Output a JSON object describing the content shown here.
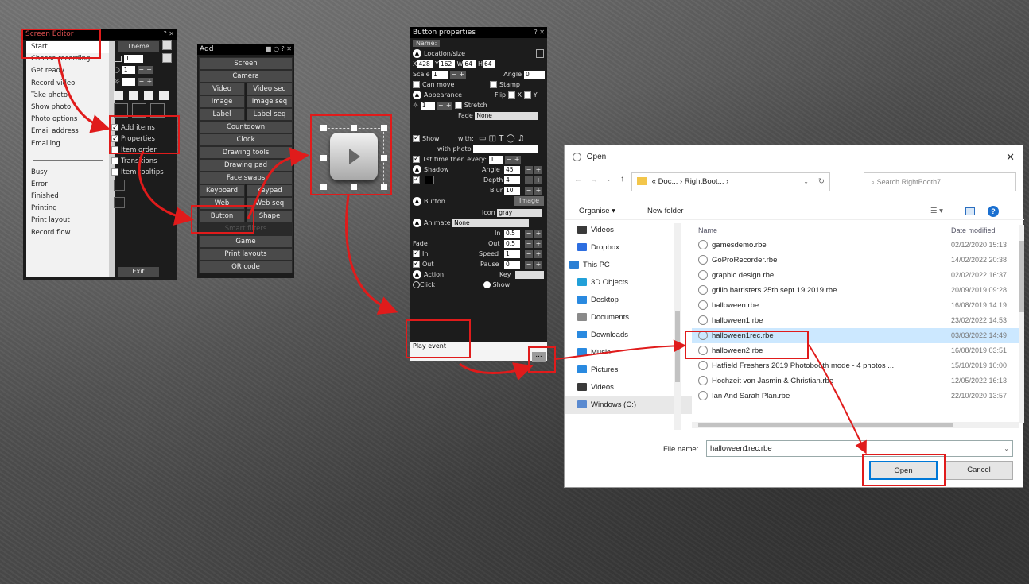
{
  "screen_editor": {
    "title": "Screen Editor",
    "list": [
      "Start",
      "Choose recording",
      "Get ready",
      "Record video",
      "Take photo",
      "Show photo",
      "Photo options",
      "Email address",
      "Emailing",
      "Busy",
      "Error",
      "Finished",
      "Printing",
      "Print layout",
      "Record flow"
    ],
    "theme_label": "Theme",
    "zoom_value": "1",
    "brightness_value": "1",
    "zoom_value2": "1",
    "checks": [
      {
        "label": "Add items",
        "checked": true
      },
      {
        "label": "Properties",
        "checked": true
      },
      {
        "label": "Item order",
        "checked": false
      },
      {
        "label": "Transitions",
        "checked": false
      },
      {
        "label": "Item tooltips",
        "checked": false
      }
    ],
    "exit_label": "Exit"
  },
  "add_panel": {
    "title": "Add",
    "full_buttons_top": [
      "Screen",
      "Camera"
    ],
    "pairs1": [
      [
        "Video",
        "Video seq"
      ],
      [
        "Image",
        "Image seq"
      ],
      [
        "Label",
        "Label seq"
      ]
    ],
    "full_buttons_mid": [
      "Countdown",
      "Clock",
      "Drawing tools",
      "Drawing pad",
      "Face swaps"
    ],
    "pairs2": [
      [
        "Keyboard",
        "Keypad"
      ],
      [
        "Web",
        "Web seq"
      ],
      [
        "Button",
        "Shape"
      ]
    ],
    "disabled": "Smart filters",
    "full_buttons_bottom": [
      "Game",
      "Print layouts",
      "QR code"
    ]
  },
  "button_properties": {
    "title": "Button properties",
    "name_label": "Name:",
    "location_label": "Location/size",
    "x_label": "X",
    "x_value": "428",
    "y_label": "Y",
    "y_value": "162",
    "w_label": "W",
    "w_value": "64",
    "h_label": "H",
    "h_value": "64",
    "scale_label": "Scale",
    "scale_value": "1",
    "angle_label": "Angle",
    "angle_value": "0",
    "can_move": "Can move",
    "stamp": "Stamp",
    "appearance_label": "Appearance",
    "flip_label": "Flip",
    "flip_x": "X",
    "flip_y": "Y",
    "stretch_label": "Stretch",
    "opacity_value": "1",
    "fade_label": "Fade",
    "fade_value": "None",
    "show_label": "Show",
    "with_label": "with:",
    "with_photo": "with photo",
    "first_time_label": "1st time then every:",
    "first_time_value": "1",
    "shadow_label": "Shadow",
    "angle2_value": "45",
    "depth_label": "Depth",
    "depth_value": "4",
    "blur_label": "Blur",
    "blur_value": "10",
    "button_section": "Button",
    "image_btn": "Image",
    "icon_label": "Icon",
    "icon_value": "gray",
    "animate_label": "Animate",
    "animate_value": "None",
    "in_label": "In",
    "in_value": "0.5",
    "out_label": "Out",
    "out_value": "0.5",
    "fade2_label": "Fade",
    "fade_in": "In",
    "fade_out": "Out",
    "speed_label": "Speed",
    "speed_value": "1",
    "pause_label": "Pause",
    "pause_value": "0",
    "action_label": "Action",
    "key_label": "Key",
    "click_label": "Click",
    "show2_label": "Show",
    "action_value": "Play event",
    "browse_label": "..."
  },
  "open_dialog": {
    "title": "Open",
    "path_parts": [
      "Doc...",
      "RightBoot...",
      ""
    ],
    "search_placeholder": "Search RightBooth7",
    "organise": "Organise ▾",
    "new_folder": "New folder",
    "nav_items": [
      {
        "label": "Videos",
        "color": "#3a3a3a"
      },
      {
        "label": "Dropbox",
        "color": "#2d6ee0"
      },
      {
        "label": "This PC",
        "color": "#2a7fd4"
      },
      {
        "label": "3D Objects",
        "color": "#22a0d8"
      },
      {
        "label": "Desktop",
        "color": "#2a8ae0"
      },
      {
        "label": "Documents",
        "color": "#8a8a8a"
      },
      {
        "label": "Downloads",
        "color": "#2a8ae0"
      },
      {
        "label": "Music",
        "color": "#2a8ae0"
      },
      {
        "label": "Pictures",
        "color": "#2a8ae0"
      },
      {
        "label": "Videos",
        "color": "#3a3a3a"
      },
      {
        "label": "Windows (C:)",
        "color": "#5a8ad0"
      }
    ],
    "col_name": "Name",
    "col_date": "Date modified",
    "files": [
      {
        "name": "gamesdemo.rbe",
        "date": "02/12/2020 15:13"
      },
      {
        "name": "GoProRecorder.rbe",
        "date": "14/02/2022 20:38"
      },
      {
        "name": "graphic design.rbe",
        "date": "02/02/2022 16:37"
      },
      {
        "name": "grillo barristers 25th sept 19 2019.rbe",
        "date": "20/09/2019 09:28"
      },
      {
        "name": "halloween.rbe",
        "date": "16/08/2019 14:19"
      },
      {
        "name": "halloween1.rbe",
        "date": "23/02/2022 14:53"
      },
      {
        "name": "halloween1rec.rbe",
        "date": "03/03/2022 14:49"
      },
      {
        "name": "halloween2.rbe",
        "date": "16/08/2019 03:51"
      },
      {
        "name": "Hatfield Freshers 2019 Photobooth mode - 4 photos ...",
        "date": "15/10/2019 10:00"
      },
      {
        "name": "Hochzeit von Jasmin & Christian.rbe",
        "date": "12/05/2022 16:13"
      },
      {
        "name": "Ian And Sarah Plan.rbe",
        "date": "22/10/2020 13:57"
      }
    ],
    "selected_index": 6,
    "file_name_label": "File name:",
    "file_name_value": "halloween1rec.rbe",
    "open_btn": "Open",
    "cancel_btn": "Cancel"
  },
  "colors": {
    "highlight": "#e01b1b",
    "selection": "#cce8ff"
  }
}
